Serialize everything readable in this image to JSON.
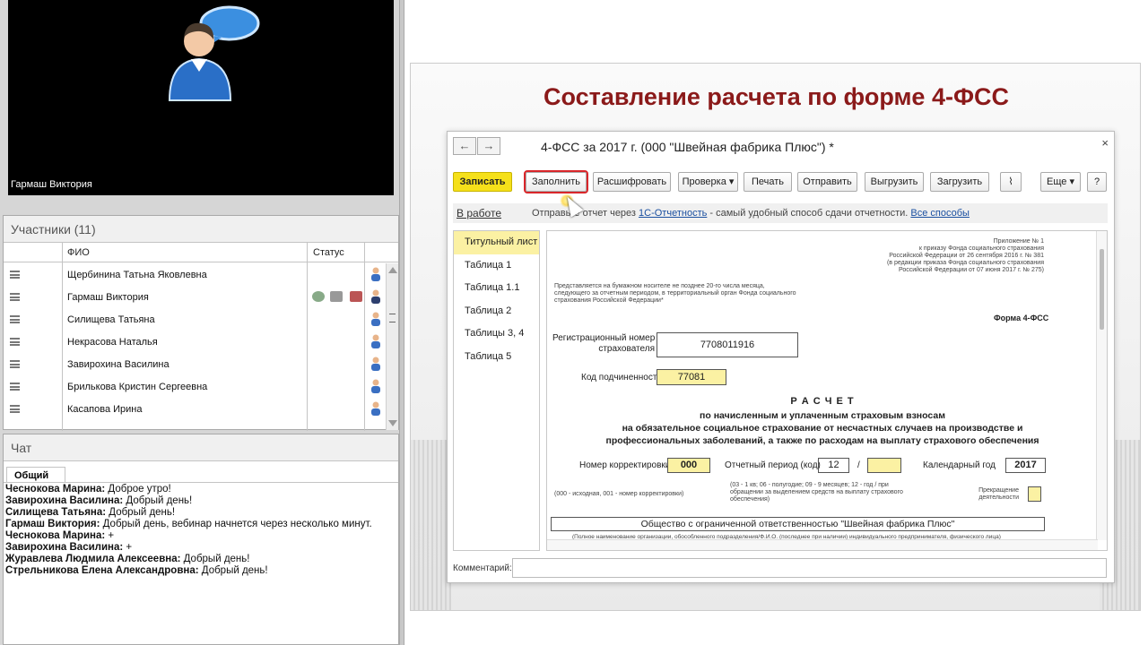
{
  "video": {
    "presenter_name": "Гармаш Виктория"
  },
  "participants": {
    "title": "Участники (11)",
    "columns": {
      "fio": "ФИО",
      "status": "Статус"
    },
    "rows": [
      {
        "name": "Щербинина Татьна Яковлевна"
      },
      {
        "name": "Гармаш Виктория"
      },
      {
        "name": "Силищева Татьяна"
      },
      {
        "name": "Некрасова Наталья"
      },
      {
        "name": "Завирохина Василина"
      },
      {
        "name": "Брилькова Кристин Сергеевна"
      },
      {
        "name": "Касапова Ирина"
      }
    ]
  },
  "chat": {
    "title": "Чат",
    "tab": "Общий",
    "messages": [
      {
        "author": "Чеснокова Марина:",
        "text": " Доброе утро!"
      },
      {
        "author": "Завирохина Василина:",
        "text": " Добрый день!"
      },
      {
        "author": "Силищева Татьяна:",
        "text": " Добрый день!"
      },
      {
        "author": "Гармаш Виктория:",
        "text": " Добрый день, вебинар начнется через несколько минут."
      },
      {
        "author": "Чеснокова Марина:",
        "text": " +"
      },
      {
        "author": "Завирохина Василина:",
        "text": " +"
      },
      {
        "author": "Журавлева  Людмила  Алексеевна:",
        "text": " Добрый день!"
      },
      {
        "author": "Стрельникова Елена Александровна:",
        "text": " Добрый день!"
      }
    ]
  },
  "slide": {
    "title": "Составление расчета по форме 4-ФСС",
    "window": {
      "title": "4-ФСС за 2017 г. (000 \"Швейная фабрика Плюс\") *",
      "close": "×",
      "back": "←",
      "forward": "→",
      "buttons": {
        "save": "Записать",
        "fill": "Заполнить",
        "decode": "Расшифровать",
        "check": "Проверка ▾",
        "print": "Печать",
        "send": "Отправить",
        "export": "Выгрузить",
        "import": "Загрузить",
        "more": "Еще ▾",
        "help": "?"
      },
      "status": {
        "state": "В работе",
        "info_prefix": "Отправьте отчет через ",
        "info_link": "1С-Отчетность",
        "info_suffix": " - самый удобный способ сдачи отчетности. ",
        "all_ways": "Все способы"
      },
      "sections": [
        "Титульный лист",
        "Таблица 1",
        "Таблица 1.1",
        "Таблица 2",
        "Таблицы 3, 4",
        "Таблица 5"
      ],
      "form": {
        "appendix": [
          "Приложение № 1",
          "к приказу Фонда социального страхования",
          "Российской Федерации от 26 сентября 2016 г. № 381",
          "(в редакции приказа Фонда социального страхования",
          "Российской Федерации от 07 июня 2017 г. № 275)"
        ],
        "note": [
          "Представляется на бумажном носителе не позднее 20-го числа месяца,",
          "следующего за отчетным периодом, в территориальный орган Фонда социального",
          "страхования Российской Федерации*"
        ],
        "form_name": "Форма 4-ФСС",
        "reg_label": [
          "Регистрационный номер",
          "страхователя"
        ],
        "reg_value": "7708011916",
        "sub_label": "Код подчиненности",
        "sub_value": "77081",
        "heading": "Р А С Ч Е Т",
        "subheading": [
          "по начисленным и уплаченным страховым взносам",
          "на обязательное социальное страхование от несчастных случаев на производстве и",
          "профессиональных заболеваний, а также по расходам на выплату страхового обеспечения"
        ],
        "corr_label": "Номер корректировки",
        "corr_value": "000",
        "period_label": "Отчетный период (код)",
        "period_value": "12",
        "slash": "/",
        "year_label": "Календарный год",
        "year_value": "2017",
        "corr_note": "(000 - исходная, 001 - номер корректировки)",
        "period_note": [
          "(03 - 1 кв; 06 - полугодие; 09 - 9 месяцев; 12 - год / при",
          "обращении за выделением средств на выплату страхового",
          "обеспечения)"
        ],
        "stop_label": [
          "Прекращение",
          "деятельности"
        ],
        "org_name": "Общество с ограниченной ответственностью \"Швейная фабрика Плюс\"",
        "org_note": "(Полное наименование организации, обособленного подразделения/Ф.И.О. (последнее при наличии) индивидуального предпринимателя, физического лица)"
      },
      "comment_label": "Комментарий:"
    }
  }
}
